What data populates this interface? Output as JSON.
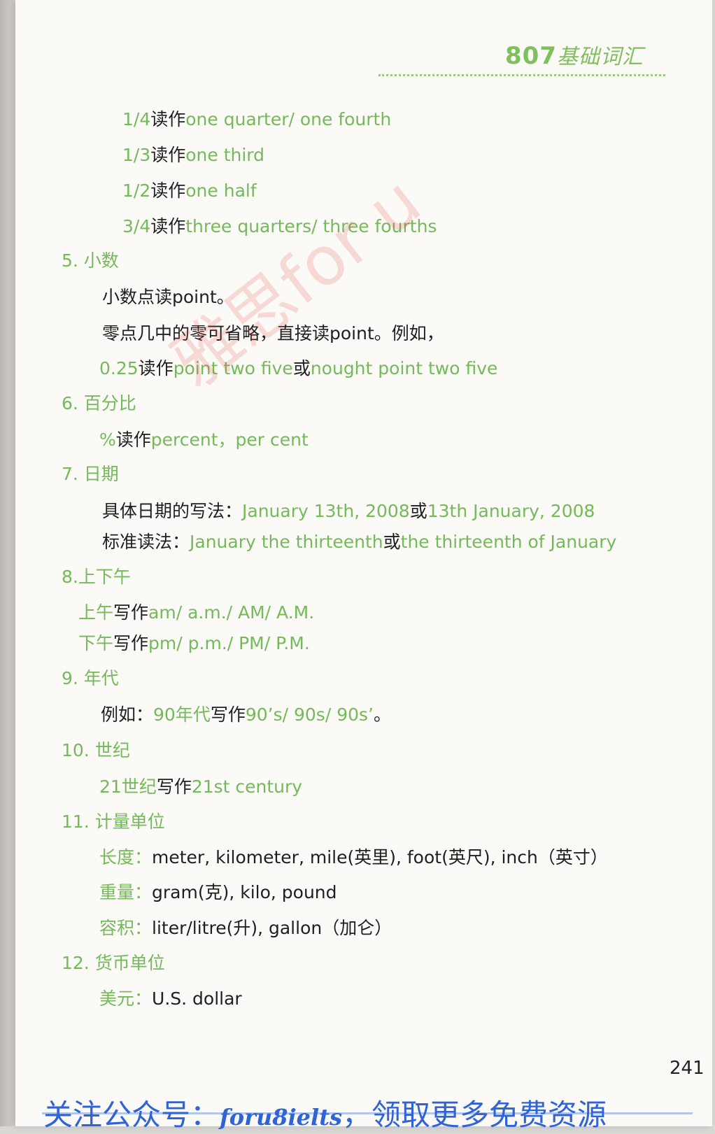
{
  "header": {
    "title_num": "807",
    "title_cn": "基础词汇"
  },
  "fractions": [
    {
      "num": "1/4",
      "reads": "读作",
      "en": "one quarter/ one fourth"
    },
    {
      "num": "1/3",
      "reads": "读作",
      "en": "one third"
    },
    {
      "num": "1/2",
      "reads": "读作",
      "en": "one half"
    },
    {
      "num": "3/4",
      "reads": "读作",
      "en": "three quarters/ three fourths"
    }
  ],
  "decimals": {
    "heading": "5. 小数",
    "line1": "小数点读point。",
    "line2": "零点几中的零可省略，直接读point。例如，",
    "ex_num": "0.25",
    "ex_reads": "读作",
    "ex_a": "point two five",
    "ex_or": "或",
    "ex_b": "nought point two five"
  },
  "percent": {
    "heading": "6. 百分比",
    "sym": "%",
    "reads": "读作",
    "en": "percent，per cent"
  },
  "dates": {
    "heading": "7. 日期",
    "write_label": "具体日期的写法：",
    "write_a": "January 13th, 2008",
    "write_or": "或",
    "write_b": "13th January, 2008",
    "read_label": "标准读法：",
    "read_a": "January the thirteenth",
    "read_or": "或",
    "read_b": "the thirteenth of January"
  },
  "ampm": {
    "heading": "8.上下午",
    "am_cn": "上午",
    "am_write": "写作",
    "am_en": "am/ a.m./ AM/ A.M.",
    "pm_cn": "下午",
    "pm_write": "写作",
    "pm_en": "pm/ p.m./ PM/ P.M."
  },
  "decades": {
    "heading": "9. 年代",
    "label": "例如：",
    "cn": "90年代",
    "write": "写作",
    "en": "90’s/ 90s/ 90s’",
    "end": "。"
  },
  "century": {
    "heading": "10. 世纪",
    "cn": "21世纪",
    "write": "写作",
    "en": "21st century"
  },
  "units": {
    "heading": "11. 计量单位",
    "length_label": "长度：",
    "length": "meter, kilometer, mile(英里), foot(英尺), inch（英寸）",
    "weight_label": "重量：",
    "weight": "gram(克), kilo, pound",
    "volume_label": "容积：",
    "volume": "liter/litre(升), gallon（加仑）"
  },
  "currency": {
    "heading": "12. 货币单位",
    "usd_label": "美元：",
    "usd": "U.S. dollar"
  },
  "page_number": "241",
  "watermark": "雅思for u",
  "footer": {
    "prefix": "关注公众号：",
    "account": "foru8ielts",
    "suffix": "，领取更多免费资源"
  }
}
